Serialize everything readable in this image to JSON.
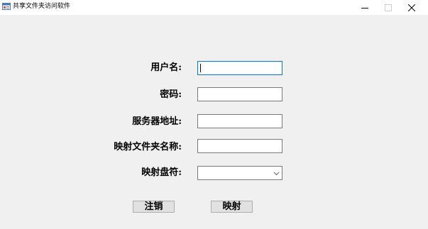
{
  "window": {
    "title": "共享文件夹访问软件",
    "minimize_symbol": "–",
    "close_symbol": "✕"
  },
  "form": {
    "username_label": "用户名:",
    "password_label": "密码:",
    "server_label": "服务器地址:",
    "mapped_folder_label": "映射文件夹名称:",
    "drive_letter_label": "映射盘符:",
    "username_value": "",
    "password_value": "",
    "server_value": "",
    "mapped_folder_value": "",
    "drive_letter_selected": ""
  },
  "buttons": {
    "logout_label": "注销",
    "map_label": "映射"
  },
  "colors": {
    "focus_border": "#0078d7",
    "window_background": "#f0f0f0",
    "titlebar_background": "#ffffff"
  },
  "icons": {
    "app": "app-window-icon",
    "minimize": "minimize-icon",
    "maximize": "maximize-icon",
    "close": "close-icon",
    "dropdown": "chevron-down-icon"
  }
}
